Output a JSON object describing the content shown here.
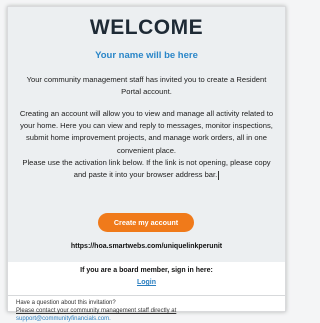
{
  "header": {
    "title": "WELCOME",
    "name_placeholder": "Your name will be here"
  },
  "body": {
    "invite_line1": "Your community management staff has invited you to create a Resident Portal account.",
    "details_line1": "Creating an account will allow you to view and manage all activity related to your home. Here you can view and reply to messages, monitor inspections, submit home improvement projects, and manage work orders, all in one convenient place.",
    "details_line2": "Please use the activation link below. If the link is not opening, please copy and paste it into your browser address bar."
  },
  "cta": {
    "button_label": "Create my account",
    "activation_url": "https://hoa.smartwebs.com/uniquelinkperunit"
  },
  "board": {
    "prompt": "If you are a board member, sign in here:",
    "login_label": "Login"
  },
  "footer": {
    "question": "Have a question about this invitation?",
    "contact_text": "Please contact your community management staff directly at",
    "email": "support@communityfinancials.com."
  },
  "colors": {
    "accent": "#f07a1a",
    "link": "#2a7ec0",
    "name_blue": "#2a86c8",
    "header_bg": "#eceff1"
  }
}
